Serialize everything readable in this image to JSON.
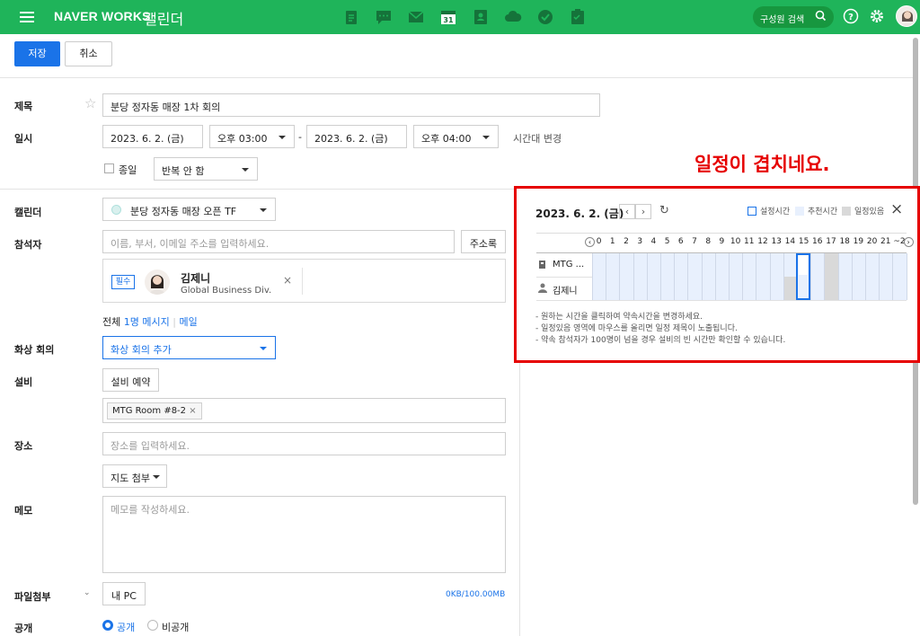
{
  "topbar": {
    "brand": "NAVER WORKS",
    "app_name": "캘린더",
    "search_label": "구성원 검색",
    "calendar_icon_day": "31",
    "apps": [
      "note-icon",
      "chat-icon",
      "mail-icon",
      "calendar-icon",
      "contacts-icon",
      "drive-icon",
      "task-icon",
      "board-icon"
    ],
    "bg_color": "#1fb45a"
  },
  "toolbar": {
    "save_label": "저장",
    "cancel_label": "취소"
  },
  "form": {
    "title_label": "제목",
    "title_value": "분당 정자동 매장 1차 회의",
    "datetime_label": "일시",
    "start_date": "2023. 6. 2. (금)",
    "start_time": "오후 03:00",
    "dash": "-",
    "end_date": "2023. 6. 2. (금)",
    "end_time": "오후 04:00",
    "timezone_link": "시간대 변경",
    "allday_label": "종일",
    "repeat_value": "반복 안 함",
    "calendar_label": "캘린더",
    "calendar_value": "분당 정자동 매장 오픈 TF",
    "attendees_label": "참석자",
    "attendees_placeholder": "이름, 부서, 이메일 주소를 입력하세요.",
    "address_book_label": "주소록",
    "attendee_badge": "필수",
    "attendee_name": "김제니",
    "attendee_dept": "Global Business Div.",
    "summary_total": "전체",
    "summary_count": "1명",
    "summary_message": "메시지",
    "summary_sep": "|",
    "summary_mail": "메일",
    "video_label": "화상 회의",
    "video_value": "화상 회의 추가",
    "equipment_label": "설비",
    "equipment_button": "설비 예약",
    "equipment_tag": "MTG Room #8-2",
    "location_label": "장소",
    "location_placeholder": "장소를 입력하세요.",
    "map_button": "지도 첨부",
    "memo_label": "메모",
    "memo_placeholder": "메모를 작성하세요.",
    "file_label": "파일첨부",
    "file_button": "내 PC",
    "file_usage": "0KB/100.00MB",
    "public_label": "공개",
    "public_option": "공개",
    "private_option": "비공개"
  },
  "overlap_note": "일정이 겹치네요.",
  "schedule": {
    "date": "2023. 6. 2. (금)",
    "legend_set": "설정시간",
    "legend_recommend": "추천시간",
    "legend_busy": "일정있음",
    "hours": [
      "0",
      "1",
      "2",
      "3",
      "4",
      "5",
      "6",
      "7",
      "8",
      "9",
      "10",
      "11",
      "12",
      "13",
      "14",
      "15",
      "16",
      "17",
      "18",
      "19",
      "20",
      "21",
      "~2"
    ],
    "rows": [
      {
        "name": "MTG ...",
        "icon": "room-icon",
        "busy_hours": [
          17
        ]
      },
      {
        "name": "김제니",
        "icon": "person-icon",
        "busy_hours": [
          14,
          17
        ]
      }
    ],
    "selected_hour": 15,
    "notes": [
      "- 원하는 시간을 클릭하여 약속시간을 변경하세요.",
      "- 일정있음 영역에 마우스를 올리면 일정 제목이 노출됩니다.",
      "- 약속 참석자가 100명이 넘을 경우 설비의 빈 시간만 확인할 수 있습니다."
    ],
    "colors": {
      "set": "#1a73e8",
      "recommend": "#e8f0fd",
      "busy": "#d9d9d9",
      "alert": "#e60000"
    }
  }
}
